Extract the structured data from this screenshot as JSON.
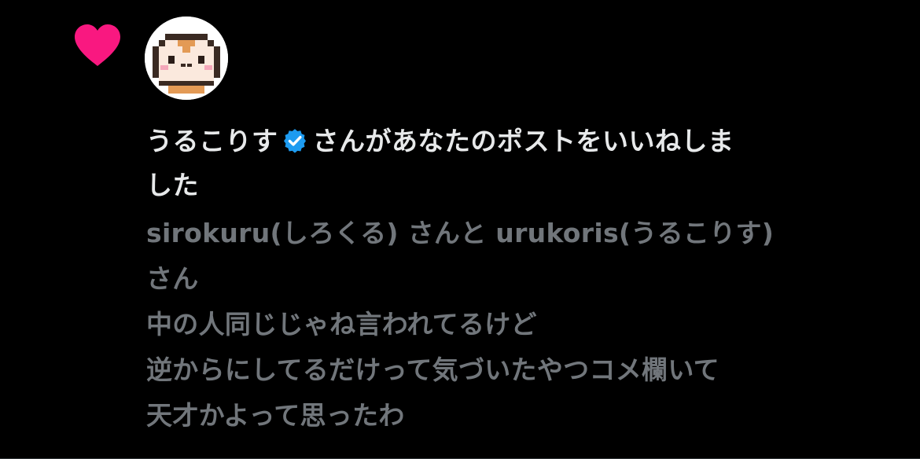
{
  "notification": {
    "type_icon": "heart-icon",
    "heart_color": "#f91880",
    "verified_color": "#1d9bf0",
    "avatar_icon": "cat-pixel-avatar",
    "user_name": "うるこりす",
    "action_line1": "さんがあなたのポストをいいねしま",
    "action_line2": "した",
    "post_lines": [
      "sirokuru(しろくる) さんと urukoris(うるこりす)",
      "さん",
      "中の人同じじゃね言われてるけど",
      "逆からにしてるだけって気づいたやつコメ欄いて",
      "天才かよって思ったわ"
    ]
  }
}
